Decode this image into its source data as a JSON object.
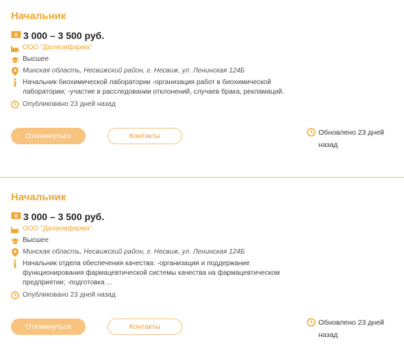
{
  "cards": [
    {
      "title": "Начальник",
      "salary": "3 000 – 3 500 руб.",
      "company": "ООО \"Далиомфарма\"",
      "education": "Высшее",
      "address": "Минская область, Несвижский район, г. Несвиж, ул. Ленинская 124Б",
      "description": "Начальник биохимической лаборатории -организация работ в биохимической лаборатории; -участие в расследовании отклонений, случаев брака, рекламаций.",
      "published": "Опубликовано 23 дней назад",
      "apply_label": "Откликнуться",
      "contacts_label": "Контакты",
      "updated": "Обновлено 23 дней назад"
    },
    {
      "title": "Начальник",
      "salary": "3 000 – 3 500 руб.",
      "company": "ООО \"Далиомфарма\"",
      "education": "Высшее",
      "address": "Минская область, Несвижский район, г. Несвиж, ул. Ленинская 124Б",
      "description": "Начальник отдела обеспечения качества: -организация и поддержание функционирования фармацевтической системы качества на фармацевтическом предприятии; -подготовка ...",
      "published": "Опубликовано 23 дней назад",
      "apply_label": "Откликнуться",
      "contacts_label": "Контакты",
      "updated": "Обновлено 23 дней назад"
    }
  ],
  "colors": {
    "accent": "#f0a535",
    "button_fill": "#f7c37f",
    "divider": "#f0c080"
  },
  "icons": [
    "money-icon",
    "factory-icon",
    "graduation-cap-icon",
    "location-pin-icon",
    "info-icon",
    "clock-icon"
  ]
}
